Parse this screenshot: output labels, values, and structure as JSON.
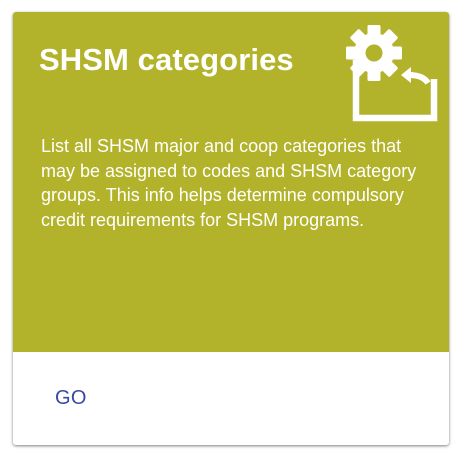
{
  "card": {
    "title": "SHSM categories",
    "description": "List all SHSM major and coop categories that may be assigned to codes and SHSM category groups. This info helps determine compulsory credit requirements for SHSM programs.",
    "icon": "settings-applications-icon",
    "action_label": "GO"
  },
  "colors": {
    "header_background": "#b3b32b",
    "header_text": "#ffffff",
    "action_text": "#3948a3"
  }
}
